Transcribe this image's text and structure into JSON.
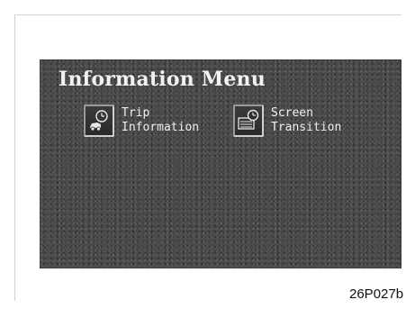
{
  "screen": {
    "title": "Information Menu",
    "buttons": [
      {
        "line1": "Trip",
        "line2": "Information",
        "icon": "car-clock-icon"
      },
      {
        "line1": "Screen",
        "line2": "Transition",
        "icon": "screen-clock-icon"
      }
    ]
  },
  "caption": "26P027b"
}
